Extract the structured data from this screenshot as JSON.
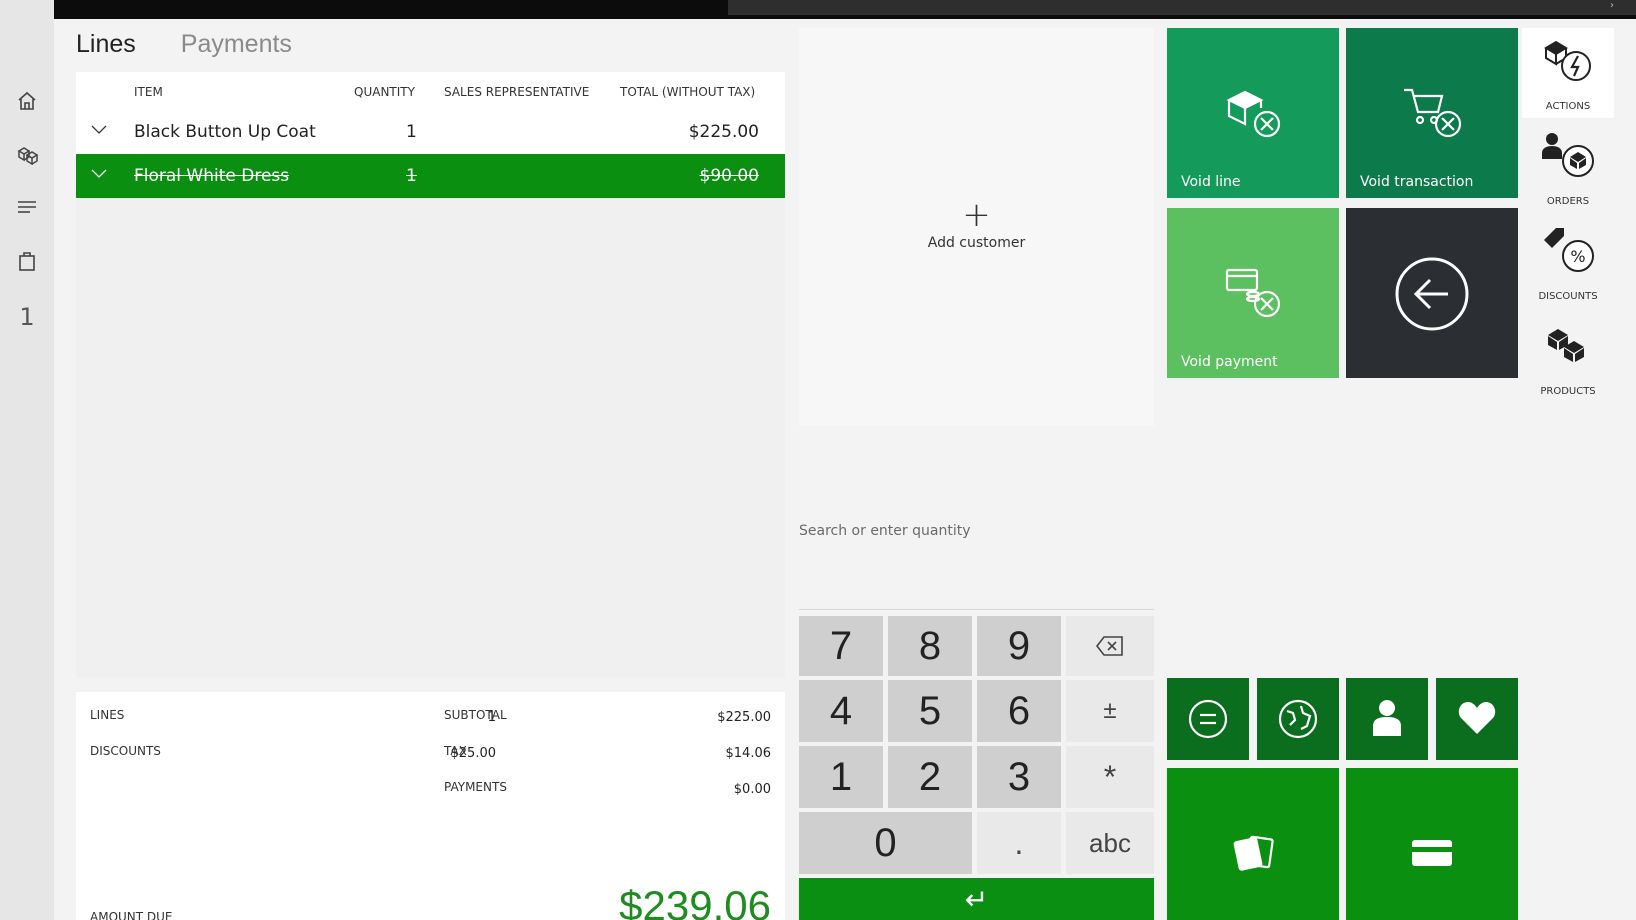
{
  "topbar": {
    "chevron": "›"
  },
  "leftnav": {
    "items": [
      {
        "name": "home",
        "icon": "home-icon"
      },
      {
        "name": "products",
        "icon": "boxes-icon"
      },
      {
        "name": "menu",
        "icon": "hamburger-icon"
      },
      {
        "name": "cart",
        "icon": "bag-icon"
      }
    ],
    "count": "1"
  },
  "tabs": [
    {
      "label": "Lines",
      "active": true
    },
    {
      "label": "Payments",
      "active": false
    }
  ],
  "grid": {
    "columns": [
      "ITEM",
      "QUANTITY",
      "SALES REPRESENTATIVE",
      "TOTAL (WITHOUT TAX)"
    ],
    "rows": [
      {
        "item": "Black Button Up Coat",
        "quantity": "1",
        "rep": "",
        "total": "$225.00",
        "voided": false
      },
      {
        "item": "Floral White Dress",
        "quantity": "1",
        "rep": "",
        "total": "$90.00",
        "voided": true
      }
    ]
  },
  "totals": {
    "lines_label": "LINES",
    "lines_value": "1",
    "discounts_label": "DISCOUNTS",
    "discounts_value": "$25.00",
    "subtotal_label": "SUBTOTAL",
    "subtotal_value": "$225.00",
    "tax_label": "TAX",
    "tax_value": "$14.06",
    "payments_label": "PAYMENTS",
    "payments_value": "$0.00",
    "amount_due_label": "AMOUNT DUE",
    "amount_due_value": "$239.06"
  },
  "customer": {
    "plus": "+",
    "add_label": "Add customer"
  },
  "search": {
    "placeholder": "Search or enter quantity"
  },
  "numpad": {
    "k7": "7",
    "k8": "8",
    "k9": "9",
    "k4": "4",
    "k5": "5",
    "k6": "6",
    "plusminus": "±",
    "k1": "1",
    "k2": "2",
    "k3": "3",
    "star": "*",
    "k0": "0",
    "dot": ".",
    "abc": "abc",
    "enter": "↵"
  },
  "tiles": {
    "void_line": "Void line",
    "void_transaction": "Void transaction",
    "void_payment": "Void payment"
  },
  "rightnav": {
    "actions": "ACTIONS",
    "orders": "ORDERS",
    "discounts": "DISCOUNTS",
    "products": "PRODUCTS"
  },
  "colors": {
    "green_dark": "#0b7a45",
    "green_void_line": "#149a5a",
    "green_void_txn": "#0c7a4a",
    "green_light": "#5cbf60",
    "dark_tile": "#2b2f33",
    "green_pay": "#0a8f11",
    "green_small": "#0a6e1e",
    "amount_due": "#1e8d1e"
  }
}
